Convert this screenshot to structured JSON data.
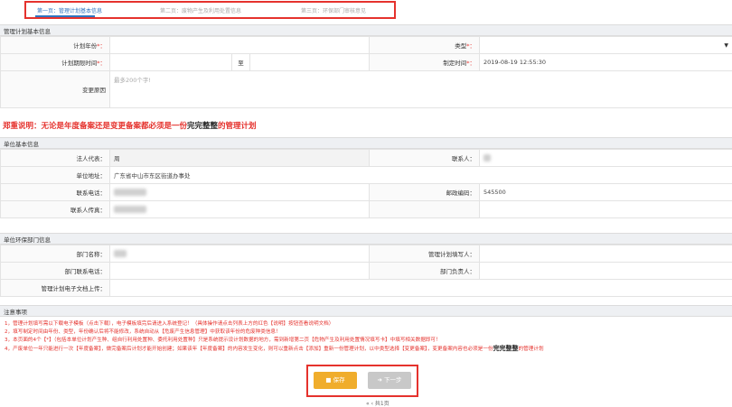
{
  "steps": [
    {
      "label": "第一页：管理计划基本信息",
      "active": true
    },
    {
      "label": "第二页：废物产生及利用处置信息",
      "active": false
    },
    {
      "label": "第三页：环保部门审核意见",
      "active": false
    }
  ],
  "section_plan": "管理计划基本信息",
  "plan": {
    "year_label": "计划年份",
    "type_label": "类型",
    "period_label": "计划期限时间",
    "period_to": "至",
    "created_label": "制定时间",
    "created_value": "2019-08-19 12:55:30",
    "reason_label": "变更原因",
    "reason_placeholder": "最多200个字!",
    "required_mark": "*："
  },
  "warning": {
    "prefix": "郑重说明：无论是年度备案还是变更备案都必须是一份",
    "bold": "完完整整",
    "suffix": "的管理计划"
  },
  "section_unit": "单位基本信息",
  "unit": {
    "rep_label": "法人代表：",
    "rep_value": "周",
    "contact_label": "联系人：",
    "address_label": "单位地址：",
    "address_value": "广东省中山市东区街道办事处",
    "phone_label": "联系电话：",
    "zip_label": "邮政编码：",
    "zip_value": "545500",
    "fax_label": "联系人传真："
  },
  "section_env": "单位环保部门信息",
  "env": {
    "dept_name_label": "部门名称：",
    "filler_label": "管理计划填写人：",
    "dept_phone_label": "部门联系电话：",
    "dept_head_label": "部门负责人：",
    "upload_label": "管理计划电子文档上传："
  },
  "section_notes": "注意事项",
  "notes": [
    "1，管理计划填写需以下载电子模板（点击下载），电子模板填完后请进入系统登记！（具体操作请点击列表上方的红色【说明】按钮查看说明文档）",
    "2，填写制定时间由年份、类型，年份确认后将不能修改，系统自动从【危废产生信息管理】中获取该年份的危废种类信息！",
    "3，本页面的4个【*】（包括本单位计划产生种、组自行利用处置种、委托利用处置种】只是系统提示设计划数据的地方，需到新增第二页【危物产生及利用处置情况填写卡】中填写相关数据即可！",
    "4，产废单位一年只能进行一次【年度备案】，做完备案后计划才能开始创建；如果该年【年度备案】的内容发生变化，则可以重新点击【添加】重新一份管理计划，以中类型选择【变更备案】，变更备案内容也必须是一份"
  ],
  "notes_tail_bold": "完完整整",
  "notes_tail": "的管理计划",
  "buttons": {
    "save": "保存",
    "next": "下一步"
  },
  "pager": "共1页"
}
